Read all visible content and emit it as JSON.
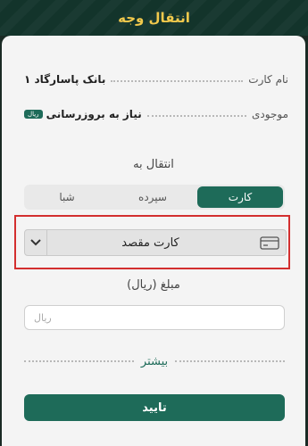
{
  "header": {
    "title": "انتقال وجه"
  },
  "account": {
    "card_name_label": "نام کارت",
    "card_name_value": "بانک پاسارگاد ۱",
    "balance_label": "موجودی",
    "balance_value": "نیاز به بروزرسانی",
    "currency_badge": "ریال"
  },
  "transfer": {
    "section_label": "انتقال به",
    "tabs": [
      {
        "label": "کارت",
        "active": true
      },
      {
        "label": "سپرده",
        "active": false
      },
      {
        "label": "شبا",
        "active": false
      }
    ],
    "destination_label": "کارت مقصد",
    "amount_label": "مبلغ (ریال)",
    "amount_placeholder": "ریال",
    "more_label": "بیشتر",
    "confirm_label": "تایید"
  },
  "colors": {
    "accent": "#1e6b59",
    "header_bg": "#13342b",
    "header_title": "#f2c94c",
    "highlight": "#d32f2f"
  }
}
